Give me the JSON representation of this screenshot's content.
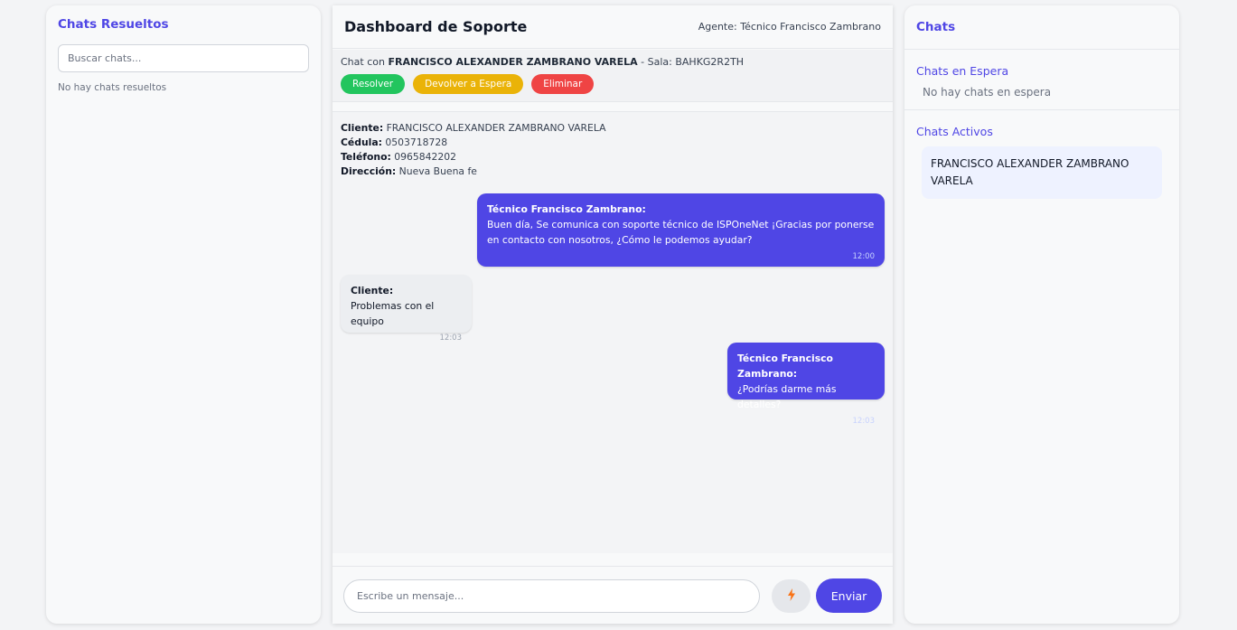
{
  "left_panel": {
    "title": "Chats Resueltos",
    "search_placeholder": "Buscar chats...",
    "empty_text": "No hay chats resueltos"
  },
  "header": {
    "title": "Dashboard de Soporte",
    "agent": "Agente: Técnico Francisco Zambrano"
  },
  "chat_bar": {
    "prefix": "Chat con",
    "client_name": "FRANCISCO ALEXANDER ZAMBRANO VARELA",
    "room_label": "- Sala: BAHKG2R2TH",
    "buttons": {
      "resolve": "Resolver",
      "return_waiting": "Devolver a Espera",
      "delete": "Eliminar"
    }
  },
  "client_info": {
    "client_label": "Cliente:",
    "client_value": "FRANCISCO ALEXANDER ZAMBRANO VARELA",
    "id_label": "Cédula:",
    "id_value": "0503718728",
    "phone_label": "Teléfono:",
    "phone_value": "0965842202",
    "address_label": "Dirección:",
    "address_value": "Nueva Buena fe"
  },
  "messages": [
    {
      "sender": "Técnico Francisco Zambrano:",
      "text": "Buen día, Se comunica con soporte técnico de ISPOneNet ¡Gracias por ponerse en contacto con nosotros, ¿Cómo le podemos ayudar?",
      "time": "12:00"
    },
    {
      "sender": "Cliente:",
      "text": "Problemas con el equipo",
      "time": "12:03"
    },
    {
      "sender": "Técnico Francisco Zambrano:",
      "text": "¿Podrías darme más detalles?",
      "time": "12:03"
    }
  ],
  "composer": {
    "placeholder": "Escribe un mensaje...",
    "quick_icon": "lightning-bolt-icon",
    "send_label": "Enviar"
  },
  "right_panel": {
    "title": "Chats",
    "waiting_title": "Chats en Espera",
    "waiting_empty": "No hay chats en espera",
    "active_title": "Chats Activos",
    "active_chats": [
      "FRANCISCO ALEXANDER ZAMBRANO VARELA"
    ]
  },
  "colors": {
    "accent": "#4f46e5",
    "resolve": "#22c55e",
    "return_waiting": "#eab308",
    "delete": "#ef4444",
    "bolt": "#f97316"
  }
}
